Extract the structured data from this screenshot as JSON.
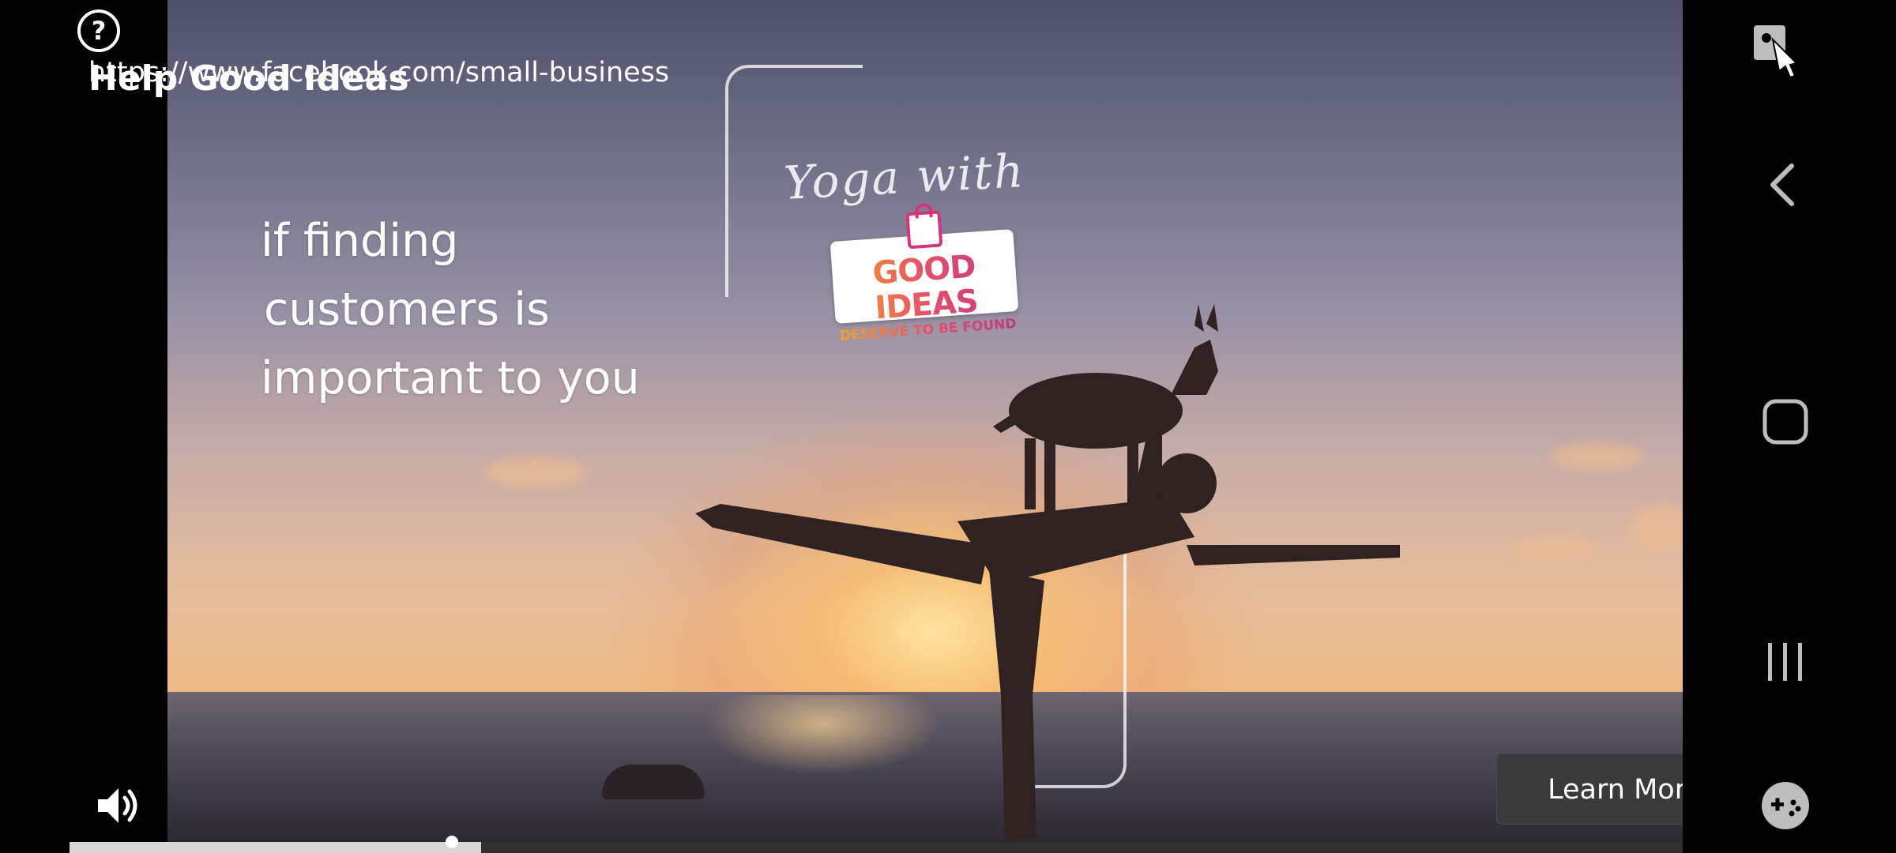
{
  "ad": {
    "title": "Help Good Ideas",
    "url": "https://www.facebook.com/small-business",
    "headline_lines": [
      "if finding",
      "customers is",
      "important to you"
    ],
    "video_script_text": "Yoga with",
    "sticker_title": "GOOD IDEAS",
    "sticker_subtitle": "DESERVE TO BE FOUND",
    "cta_label": "Learn More",
    "progress_fraction": 0.255
  },
  "icons": {
    "help": "help-circle-icon",
    "close": "close-icon",
    "volume": "volume-icon",
    "accessibility": "accessibility-icon",
    "back": "back-chevron-icon",
    "home": "home-icon",
    "recents": "recents-icon",
    "game": "game-controller-icon"
  },
  "help_glyph": "?"
}
